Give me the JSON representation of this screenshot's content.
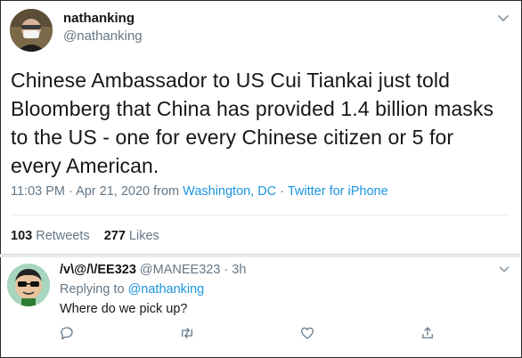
{
  "tweet": {
    "display_name": "nathanking",
    "handle": "@nathanking",
    "text": "Chinese Ambassador to US Cui Tiankai just told Bloomberg that China has provided 1.4 billion masks to the US - one for every Chinese citizen or 5 for every American.",
    "time": "11:03 PM · Apr 21, 2020 from ",
    "location": "Washington, DC",
    "separator": " · ",
    "source": "Twitter for iPhone",
    "retweets_count": "103",
    "retweets_label": "Retweets",
    "likes_count": "277",
    "likes_label": "Likes",
    "menu_icon": "chevron-down-icon"
  },
  "reply": {
    "display_name": "/v\\@/\\/EE323",
    "handle": "@MANEE323",
    "time": " · 3h",
    "replying_prefix": "Replying to ",
    "replying_to": "@nathanking",
    "text": "Where do we pick up?",
    "icons": [
      "reply-icon",
      "retweet-icon",
      "like-icon",
      "share-icon"
    ]
  },
  "colors": {
    "link": "#1b95e0",
    "secondary_text": "#657786",
    "primary_text": "#14171a",
    "divider": "#e6ecf0"
  }
}
